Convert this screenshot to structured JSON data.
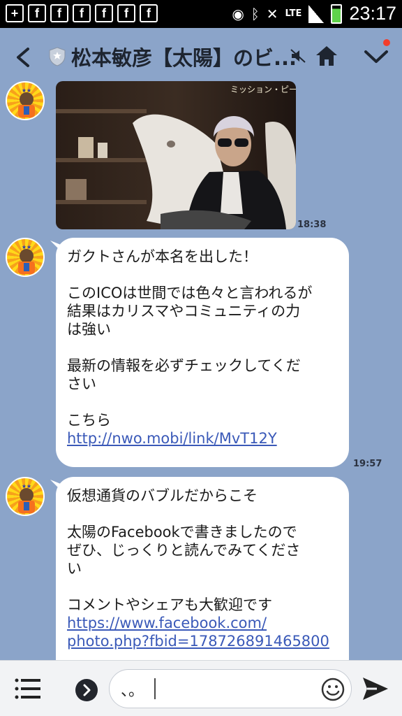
{
  "status_bar": {
    "left_icons": [
      "add-icon",
      "facebook-icon",
      "facebook-icon",
      "facebook-icon",
      "facebook-icon",
      "facebook-icon",
      "facebook-icon"
    ],
    "lte": "LTE",
    "time": "23:17"
  },
  "header": {
    "title": "松本敏彦【太陽】のビ..."
  },
  "messages": [
    {
      "type": "image",
      "time": "18:38"
    },
    {
      "type": "text",
      "time": "19:57",
      "lines": [
        "ガクトさんが本名を出した！",
        "",
        "このICOは世間では色々と言われるが",
        "結果はカリスマやコミュニティの力",
        "は強い",
        "",
        "最新の情報を必ずチェックしてくだ",
        "さい",
        "",
        "こちら"
      ],
      "link": "http://nwo.mobi/link/MvT12Y"
    },
    {
      "type": "text",
      "lines": [
        "仮想通貨のバブルだからこそ",
        "",
        "太陽のFacebookで書きましたので",
        "ぜひ、じっくりと読んでみてくださ",
        "い",
        "",
        "コメントやシェアも大歓迎です"
      ],
      "link_lines": [
        "https://www.facebook.com/",
        "photo.php?fbid=178726891465800"
      ]
    }
  ],
  "input": {
    "value": "、。"
  },
  "colors": {
    "background": "#8ba4c9",
    "link": "#3a59b8"
  }
}
